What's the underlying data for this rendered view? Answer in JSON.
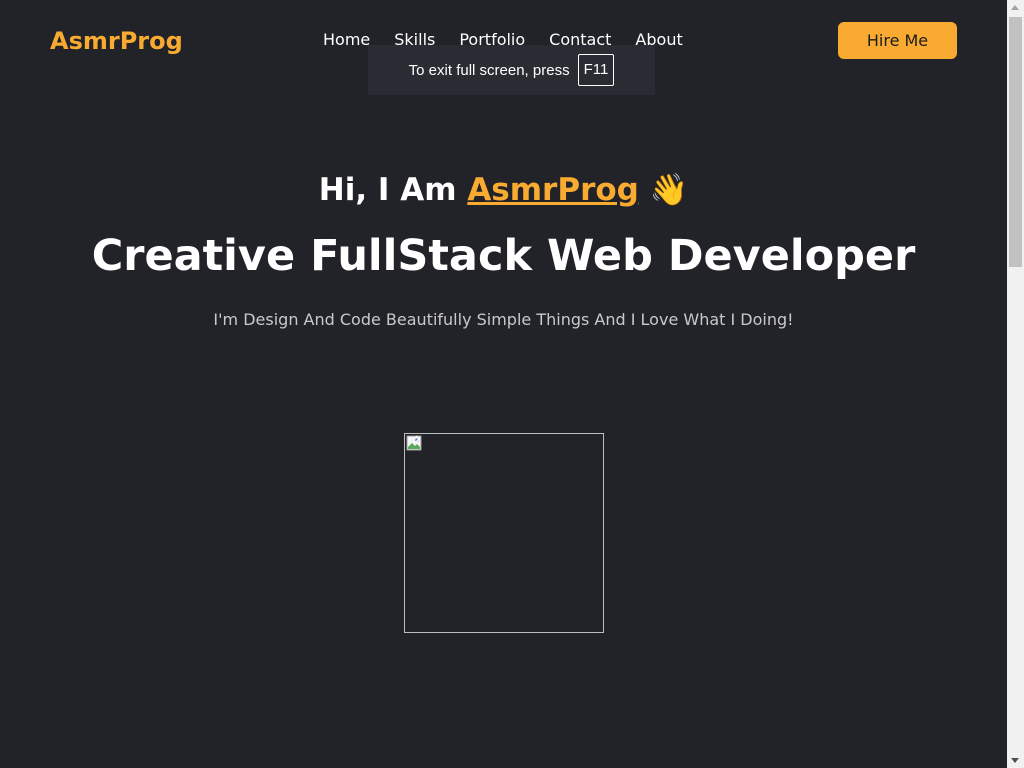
{
  "header": {
    "logo": "AsmrProg",
    "nav": [
      "Home",
      "Skills",
      "Portfolio",
      "Contact",
      "About"
    ],
    "hire_label": "Hire Me"
  },
  "fullscreen_toast": {
    "text": "To exit full screen, press",
    "key": "F11"
  },
  "hero": {
    "greeting_prefix": "Hi, I Am",
    "name": "AsmrProg",
    "emoji": "👋",
    "title": "Creative FullStack Web Developer",
    "subtitle": "I'm Design And Code Beautifully Simple Things And I Love What I Doing!"
  },
  "colors": {
    "background": "#212328",
    "accent": "#f9ab31",
    "text": "#ffffff"
  },
  "icons": {
    "hero_image": "broken-image-icon",
    "hand": "waving-hand-emoji"
  }
}
